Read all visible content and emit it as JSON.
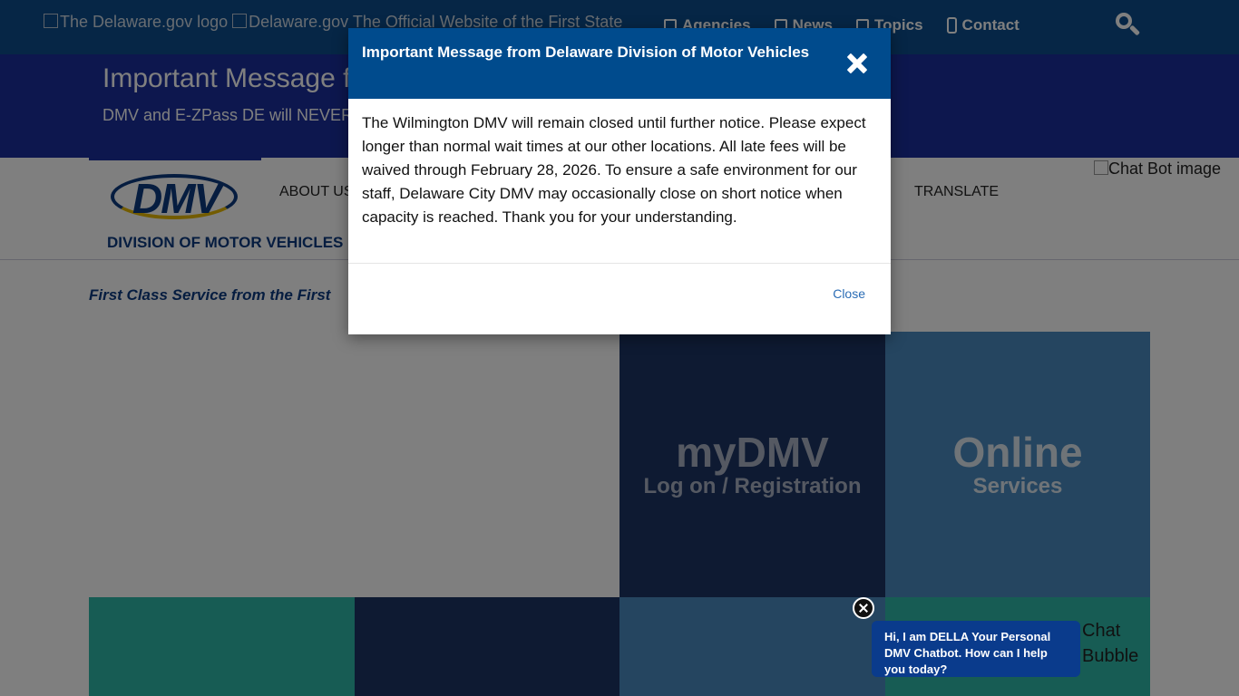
{
  "topbar": {
    "logo_alt": "The Delaware.gov logo",
    "site_alt": "Delaware.gov",
    "site_tagline": "The Official Website of the First State",
    "nav": [
      {
        "label": "Agencies",
        "icon": "building-icon"
      },
      {
        "label": "News",
        "icon": "newspaper-icon"
      },
      {
        "label": "Topics",
        "icon": "chat-icon"
      },
      {
        "label": "Contact",
        "icon": "phone-icon"
      }
    ],
    "search_icon": "search-icon"
  },
  "banner": {
    "title": "Important Message f",
    "text": "DMV and E-ZPass DE will NEVER ... d emails with account updates. To report a text go to ReportFraud.ftc"
  },
  "header": {
    "logo_text": "DMV",
    "division": "DIVISION OF MOTOR VEHICLES",
    "nav_about": "ABOUT US",
    "nav_translate": "TRANSLATE",
    "chatbot_alt": "Chat Bot image"
  },
  "tagline": "First Class Service from the First",
  "tiles": {
    "mydmv_big": "myDMV",
    "mydmv_small": "Log on / Registration",
    "online_big": "Online",
    "online_small": "Services"
  },
  "modal": {
    "title": "Important Message from Delaware Division of Motor Vehicles",
    "body": "The Wilmington DMV will remain closed until further notice. Please expect longer than normal wait times at our other locations. All late fees will be waived through February 28, 2026. To ensure a safe environment for our staff, Delaware City DMV may occasionally close on short notice when capacity is reached. Thank you for your understanding.",
    "close_label": "Close"
  },
  "chat": {
    "message": "Hi, I am DELLA Your Personal DMV Chatbot. How can I help you today?",
    "bubble_alt": "Chat Bubble"
  },
  "colors": {
    "topbar": "#0d4d8c",
    "banner": "#1b2f9c",
    "modal_header": "#004b8d",
    "chat_bubble": "#0a3b8c"
  }
}
